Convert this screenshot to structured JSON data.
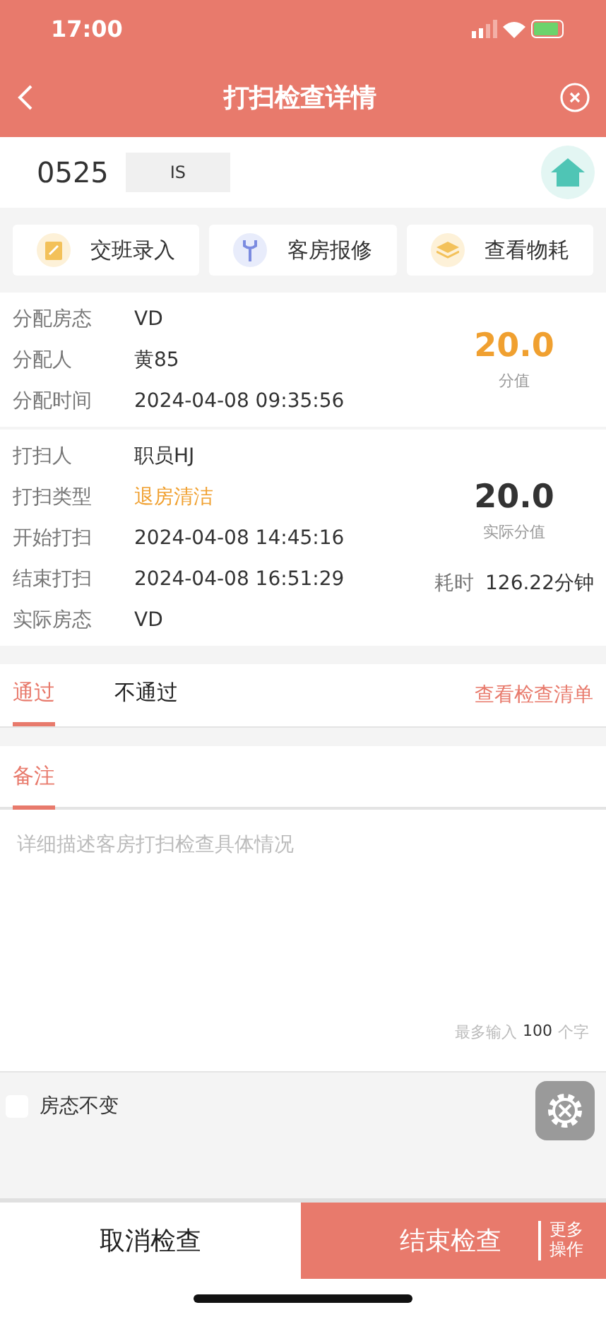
{
  "status_bar": {
    "time": "17:00"
  },
  "header": {
    "title": "打扫检查详情"
  },
  "room": {
    "number": "0525",
    "status": "IS"
  },
  "actions": [
    {
      "label": "交班录入",
      "kind": "note"
    },
    {
      "label": "客房报修",
      "kind": "wrench"
    },
    {
      "label": "查看物耗",
      "kind": "layers"
    }
  ],
  "assignment": {
    "rows": [
      {
        "label": "分配房态",
        "value": "VD",
        "highlight": false
      },
      {
        "label": "分配人",
        "value": "黄85",
        "highlight": false
      },
      {
        "label": "分配时间",
        "value": "2024-04-08 09:35:56",
        "highlight": false
      }
    ],
    "score": "20.0",
    "score_label": "分值"
  },
  "cleaning": {
    "rows": [
      {
        "label": "打扫人",
        "value": "职员HJ",
        "highlight": false
      },
      {
        "label": "打扫类型",
        "value": "退房清洁",
        "highlight": true
      },
      {
        "label": "开始打扫",
        "value": "2024-04-08 14:45:16",
        "highlight": false
      },
      {
        "label": "结束打扫",
        "value": "2024-04-08 16:51:29",
        "highlight": false
      },
      {
        "label": "实际房态",
        "value": "VD",
        "highlight": false
      }
    ],
    "score": "20.0",
    "score_label": "实际分值",
    "duration_label": "耗时",
    "duration": "126.22分钟"
  },
  "result_tabs": [
    {
      "label": "通过",
      "selected": true
    },
    {
      "label": "不通过",
      "selected": false
    }
  ],
  "checklist_link": "查看检查清单",
  "remark": {
    "title": "备注",
    "placeholder": "详细描述客房打扫检查具体情况",
    "counter_prefix": "最多输入",
    "counter_value": "100",
    "counter_suffix": "个字"
  },
  "keep_status": {
    "label": "房态不变",
    "checked": false
  },
  "footer": {
    "cancel": "取消检查",
    "finish": "结束检查",
    "more": "更多操作"
  }
}
